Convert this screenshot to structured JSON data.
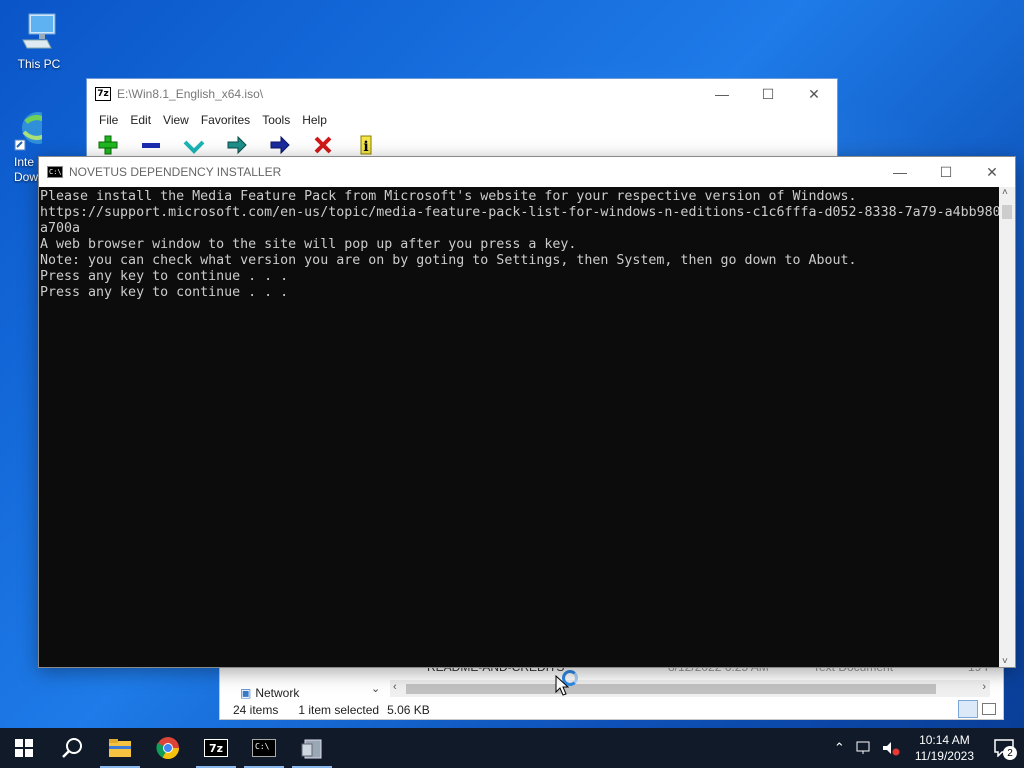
{
  "desktop": {
    "icons": [
      {
        "label": "This PC"
      },
      {
        "label": "Inte\nDow"
      }
    ]
  },
  "window_7zip": {
    "title": "E:\\Win8.1_English_x64.iso\\",
    "menu": [
      "File",
      "Edit",
      "View",
      "Favorites",
      "Tools",
      "Help"
    ],
    "toolbar_icons": [
      "add-icon",
      "extract-icon",
      "test-icon",
      "copy-icon",
      "move-icon",
      "delete-icon",
      "info-icon"
    ]
  },
  "explorer": {
    "partial_row_left": "Network",
    "file_row": {
      "name": "README-AND-CREDITS",
      "date": "8/12/2022 6:25 AM",
      "type": "Text Document",
      "size": "19 I"
    },
    "status": {
      "items": "24 items",
      "selected": "1 item selected",
      "size": "5.06 KB"
    }
  },
  "console": {
    "title": "NOVETUS DEPENDENCY INSTALLER",
    "lines": [
      "Please install the Media Feature Pack from Microsoft's website for your respective version of Windows.",
      "https://support.microsoft.com/en-us/topic/media-feature-pack-list-for-windows-n-editions-c1c6fffa-d052-8338-7a79-a4bb980",
      "a700a",
      "A web browser window to the site will pop up after you press a key.",
      "Note: you can check what version you are on by goting to Settings, then System, then go down to About.",
      "Press any key to continue . . .",
      "Press any key to continue . . ."
    ]
  },
  "taskbar": {
    "apps": [
      "start",
      "search",
      "file-explorer",
      "chrome",
      "7zip",
      "cmd",
      "installer"
    ],
    "time": "10:14 AM",
    "date": "11/19/2023",
    "notifications": "2"
  }
}
